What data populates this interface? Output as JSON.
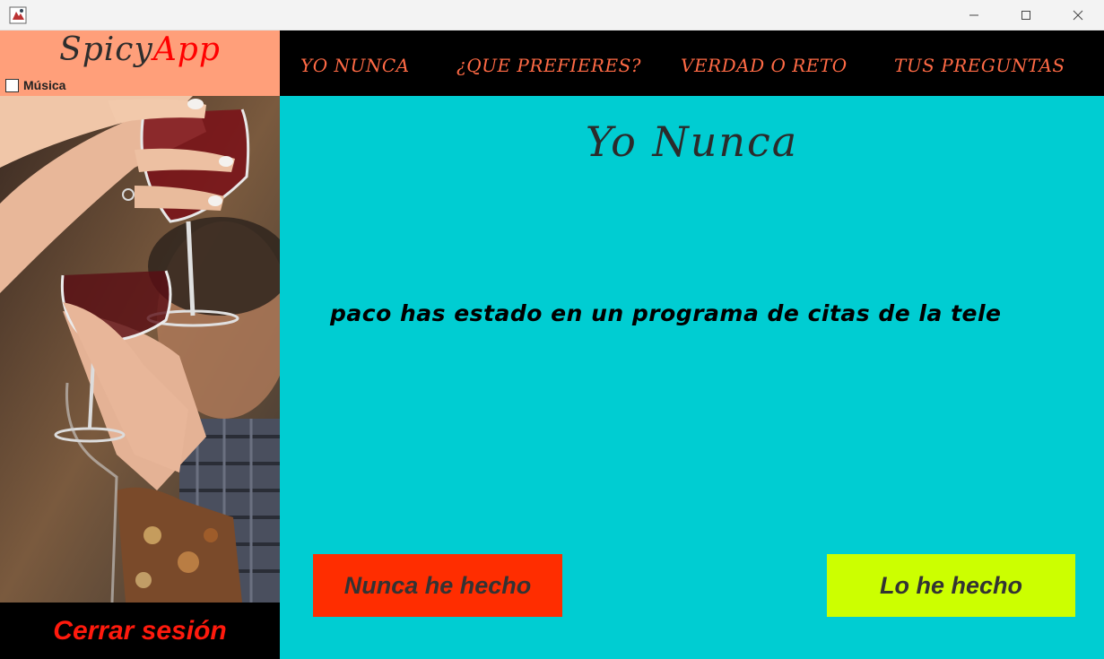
{
  "window": {
    "controls": {
      "minimize": "—",
      "maximize": "☐",
      "close": "✕"
    }
  },
  "brand": {
    "part1": "Spicy",
    "part2": "App"
  },
  "music": {
    "label": "Música",
    "checked": false
  },
  "photo": {
    "icon": "wine-glasses-photo"
  },
  "nav": {
    "items": [
      {
        "label": "YO NUNCA"
      },
      {
        "label": "¿QUE PREFIERES?"
      },
      {
        "label": "VERDAD O RETO"
      },
      {
        "label": "TUS PREGUNTAS"
      }
    ]
  },
  "main": {
    "title": "Yo Nunca",
    "question": "paco has estado en un programa de citas de la tele",
    "never_label": "Nunca he hecho",
    "done_label": "Lo he hecho"
  },
  "logout": {
    "label": "Cerrar sesión"
  },
  "colors": {
    "brand_box": "#ff9f7a",
    "nav_text": "#ff6a45",
    "main_bg": "#00cdd2",
    "never_button": "#ff2d00",
    "done_button": "#ccff00",
    "logout_text": "#ff1a0d"
  }
}
